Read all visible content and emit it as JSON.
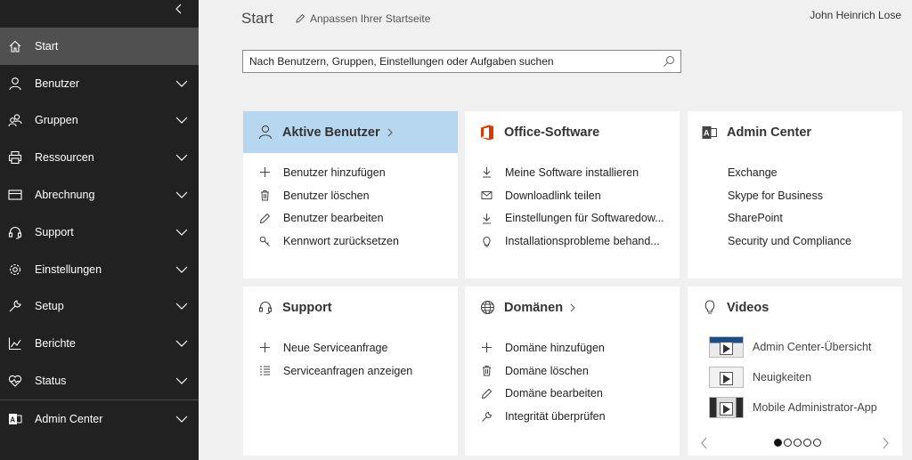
{
  "sidebar": {
    "items": [
      {
        "label": "Start",
        "icon": "home-icon",
        "active": true
      },
      {
        "label": "Benutzer",
        "icon": "user-icon"
      },
      {
        "label": "Gruppen",
        "icon": "group-icon"
      },
      {
        "label": "Ressourcen",
        "icon": "printer-icon"
      },
      {
        "label": "Abrechnung",
        "icon": "credit-card-icon"
      },
      {
        "label": "Support",
        "icon": "headset-icon"
      },
      {
        "label": "Einstellungen",
        "icon": "gear-icon"
      },
      {
        "label": "Setup",
        "icon": "wrench-icon"
      },
      {
        "label": "Berichte",
        "icon": "chart-icon"
      },
      {
        "label": "Status",
        "icon": "heartbeat-icon"
      },
      {
        "label": "Admin Center",
        "icon": "admin-center-icon"
      }
    ]
  },
  "header": {
    "title": "Start",
    "customize_label": "Anpassen Ihrer Startseite",
    "user_name": "John Heinrich Lose"
  },
  "search": {
    "placeholder": "Nach Benutzern, Gruppen, Einstellungen oder Aufgaben suchen"
  },
  "cards": {
    "active_users": {
      "title": "Aktive Benutzer",
      "items": [
        "Benutzer hinzufügen",
        "Benutzer löschen",
        "Benutzer bearbeiten",
        "Kennwort zurücksetzen"
      ]
    },
    "office": {
      "title": "Office-Software",
      "items": [
        "Meine Software installieren",
        "Downloadlink teilen",
        "Einstellungen für Softwaredow...",
        "Installationsprobleme behand..."
      ]
    },
    "admin_center": {
      "title": "Admin Center",
      "items": [
        "Exchange",
        "Skype for Business",
        "SharePoint",
        "Security und Compliance"
      ]
    },
    "support": {
      "title": "Support",
      "items": [
        "Neue Serviceanfrage",
        "Serviceanfragen anzeigen"
      ]
    },
    "domains": {
      "title": "Domänen",
      "items": [
        "Domäne hinzufügen",
        "Domäne löschen",
        "Domäne bearbeiten",
        "Integrität überprüfen"
      ]
    },
    "videos": {
      "title": "Videos",
      "items": [
        "Admin Center-Übersicht",
        "Neuigkeiten",
        "Mobile Administrator-App"
      ],
      "carousel_page": 1,
      "carousel_total": 5
    }
  },
  "colors": {
    "sidebar_bg": "#212121",
    "sidebar_active": "#505050",
    "highlight_card": "#b7d6ef",
    "office_red": "#d83b01",
    "page_bg": "#f0f0f0"
  }
}
